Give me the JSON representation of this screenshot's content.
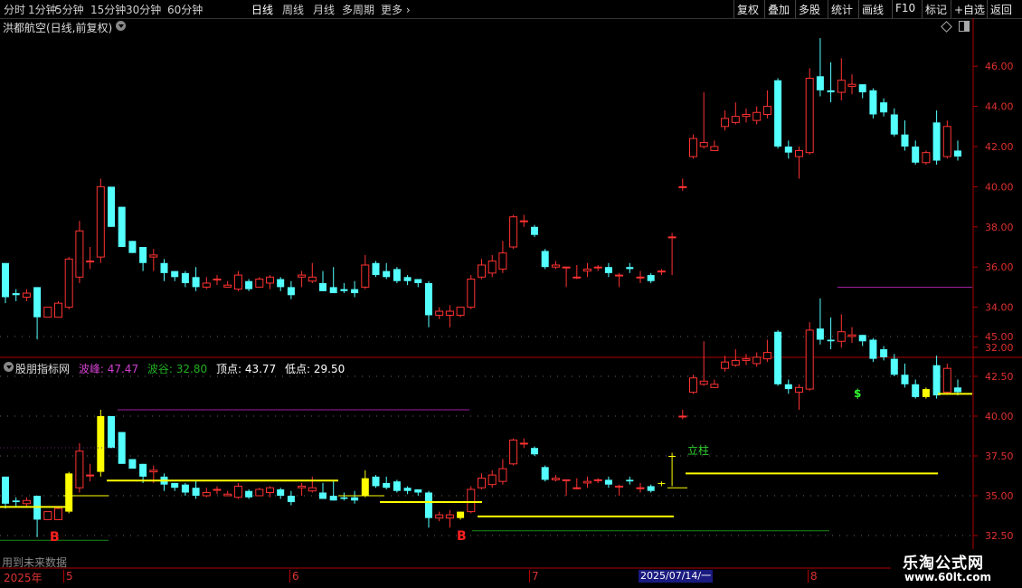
{
  "toolbar": {
    "periods": [
      "分时",
      "1分钟",
      "5分钟",
      "15分钟",
      "30分钟",
      "60分钟",
      "日线",
      "周线",
      "月线",
      "多周期",
      "更多"
    ],
    "active": "日线",
    "actions": [
      "复权",
      "叠加",
      "多股",
      "统计",
      "画线",
      "F10",
      "标记",
      "+自选",
      "返回"
    ]
  },
  "panel1": {
    "title": "洪都航空(日线,前复权)",
    "y_ticks": [
      "46.00",
      "44.00",
      "42.00",
      "40.00",
      "38.00",
      "36.00",
      "34.00",
      "32.00"
    ]
  },
  "panel2": {
    "title": "股朋指标网",
    "peak_label": "波峰:",
    "peak_value": "47.47",
    "trough_label": "波谷:",
    "trough_value": "32.80",
    "top_label": "顶点:",
    "top_value": "43.77",
    "low_label": "低点:",
    "low_value": "29.50",
    "y_ticks": [
      "45.00",
      "42.50",
      "40.00",
      "37.50",
      "35.00",
      "32.50"
    ],
    "annotations": {
      "b1": "B",
      "b2": "B",
      "lizhu": "立柱",
      "dollar": "$"
    }
  },
  "footer": {
    "future_text": "用到未来数据",
    "time_labels": [
      "2025年",
      "5",
      "6",
      "7",
      "8"
    ],
    "date_box": "2025/07/14/一"
  },
  "watermark": {
    "line1": "乐淘公式网",
    "line2": "www.60lt.com"
  },
  "colors": {
    "up": "#ff3232",
    "down": "#54ffff",
    "yellow": "#ffff00",
    "purple": "#a020a0",
    "green": "#1a8a1a",
    "axis": "#b00000",
    "label_magenta": "#d040d0",
    "label_green": "#20b020"
  },
  "chart_data": {
    "type": "candlestick",
    "series_open": [
      36.2,
      34.7,
      34.5,
      35.0,
      33.5,
      33.5,
      34.0,
      35.5,
      36.3,
      36.5,
      40.0,
      39.0,
      37.3,
      37.0,
      36.5,
      36.2,
      35.8,
      35.7,
      35.5,
      35.0,
      35.4,
      35.0,
      34.9,
      35.3,
      35.0,
      35.2,
      35.4,
      35.0,
      35.5,
      35.3,
      35.2,
      35.0,
      34.9,
      34.9,
      35.0,
      36.2,
      35.8,
      35.9,
      35.5,
      35.4,
      35.2,
      33.6,
      33.6,
      33.6,
      34.0,
      35.5,
      35.7,
      35.9,
      37.0,
      38.3,
      38.0,
      36.8,
      36.0,
      36.0,
      35.5,
      35.8,
      36.0,
      36.0,
      35.6,
      36.0,
      35.5,
      35.6,
      35.8,
      37.5,
      40.0,
      41.5,
      42.0,
      41.8,
      43.0,
      43.2,
      43.5,
      43.3,
      43.6,
      45.3,
      42.0,
      41.5,
      41.7,
      45.5,
      44.8,
      44.7,
      45.0,
      45.1,
      44.8,
      44.2,
      43.6,
      42.6,
      42.0,
      41.2,
      43.2,
      41.5,
      41.8
    ],
    "series_close": [
      34.5,
      34.6,
      34.7,
      33.5,
      34.0,
      34.2,
      36.4,
      37.8,
      36.3,
      40.0,
      38.0,
      37.0,
      36.7,
      36.2,
      36.6,
      35.7,
      35.5,
      35.2,
      35.0,
      35.2,
      35.4,
      35.1,
      35.6,
      34.9,
      35.4,
      35.5,
      35.0,
      34.6,
      35.6,
      35.5,
      34.8,
      34.7,
      34.8,
      34.7,
      36.1,
      35.6,
      35.5,
      35.3,
      35.3,
      35.2,
      33.6,
      33.8,
      33.8,
      34.0,
      35.4,
      36.1,
      36.3,
      36.7,
      38.5,
      38.3,
      37.6,
      36.0,
      36.1,
      36.0,
      35.5,
      35.9,
      36.0,
      35.7,
      35.6,
      35.9,
      35.5,
      35.3,
      35.8,
      37.5,
      40.0,
      42.4,
      42.2,
      42.0,
      43.4,
      43.5,
      43.6,
      43.7,
      44.0,
      42.0,
      41.7,
      41.8,
      45.4,
      44.8,
      44.7,
      45.3,
      45.1,
      44.7,
      43.6,
      43.7,
      42.6,
      42.0,
      41.2,
      41.7,
      41.3,
      43.0,
      41.5
    ],
    "series_high": [
      36.2,
      34.9,
      34.9,
      35.0,
      33.8,
      34.3,
      36.5,
      38.3,
      37.0,
      40.4,
      40.0,
      39.0,
      37.3,
      37.0,
      36.9,
      36.4,
      35.8,
      35.8,
      36.0,
      35.5,
      35.6,
      35.3,
      35.8,
      35.4,
      35.5,
      35.6,
      35.5,
      35.3,
      35.8,
      36.2,
      35.8,
      36.0,
      35.2,
      35.3,
      36.6,
      36.3,
      36.2,
      36.0,
      35.6,
      35.4,
      35.3,
      34.0,
      34.1,
      34.0,
      35.6,
      36.4,
      36.6,
      37.3,
      38.6,
      38.6,
      38.1,
      36.9,
      36.3,
      36.0,
      36.1,
      36.2,
      36.1,
      36.2,
      35.7,
      36.2,
      35.8,
      35.7,
      35.9,
      37.7,
      40.4,
      42.6,
      44.7,
      42.3,
      43.8,
      44.2,
      43.9,
      44.0,
      44.8,
      45.4,
      42.3,
      42.0,
      45.9,
      47.4,
      46.2,
      46.4,
      45.6,
      45.1,
      44.9,
      44.4,
      43.9,
      43.3,
      42.3,
      41.8,
      43.8,
      43.3,
      42.3
    ],
    "series_low": [
      34.2,
      34.3,
      34.3,
      32.4,
      33.5,
      33.5,
      33.9,
      35.2,
      35.9,
      36.2,
      38.0,
      37.0,
      36.7,
      35.8,
      35.8,
      35.3,
      35.3,
      35.0,
      34.8,
      34.9,
      35.1,
      35.0,
      34.8,
      34.8,
      35.0,
      34.9,
      34.8,
      34.4,
      35.0,
      35.2,
      34.8,
      34.7,
      34.7,
      34.5,
      34.9,
      35.5,
      35.4,
      35.2,
      35.1,
      35.0,
      33.0,
      33.4,
      33.0,
      33.5,
      33.9,
      35.4,
      35.5,
      35.7,
      36.9,
      38.0,
      37.5,
      35.9,
      35.9,
      35.0,
      35.4,
      35.5,
      35.8,
      35.5,
      35.0,
      35.7,
      35.2,
      35.2,
      35.6,
      35.6,
      39.8,
      41.4,
      41.9,
      41.8,
      42.8,
      43.1,
      43.2,
      43.1,
      43.4,
      41.9,
      41.4,
      40.4,
      41.6,
      44.5,
      44.2,
      44.3,
      44.6,
      44.4,
      43.4,
      43.5,
      42.5,
      41.8,
      41.1,
      41.1,
      41.1,
      41.4,
      41.3
    ]
  }
}
